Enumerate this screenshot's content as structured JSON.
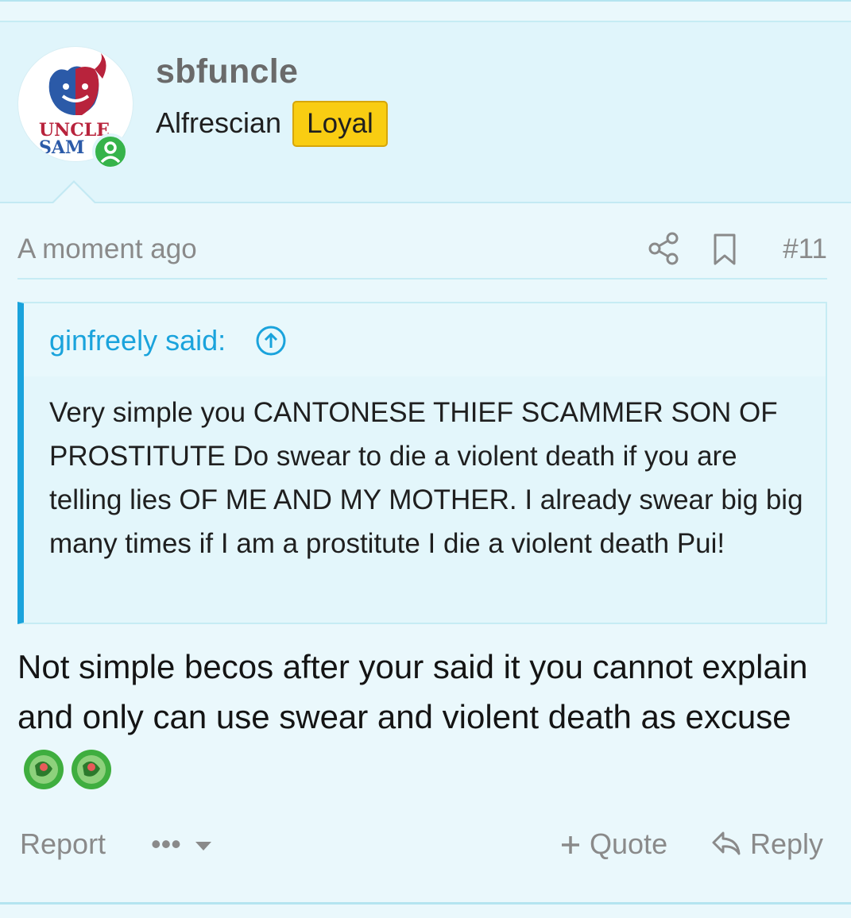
{
  "post": {
    "username": "sbfuncle",
    "user_title": "Alfrescian",
    "badge": "Loyal",
    "avatar_text_line1": "UNCLE",
    "avatar_text_line2": "SAM",
    "timestamp": "A moment ago",
    "post_number": "#11",
    "quote": {
      "author": "ginfreely said:",
      "body": "Very simple you CANTONESE THIEF SCAMMER SON OF PROSTITUTE Do swear to die a violent death if you are telling lies OF ME AND MY MOTHER. I already swear big big many times if I am a prostitute I die a violent death Pui!"
    },
    "message": "Not simple becos after your said it you cannot explain and only can use swear and violent death as excuse",
    "actions": {
      "report": "Report",
      "more": "•••",
      "quote": "Quote",
      "reply": "Reply"
    }
  },
  "colors": {
    "accent": "#1aa3dc",
    "badge": "#f9cd12",
    "online": "#36b34a",
    "background": "#eaf8fc"
  }
}
